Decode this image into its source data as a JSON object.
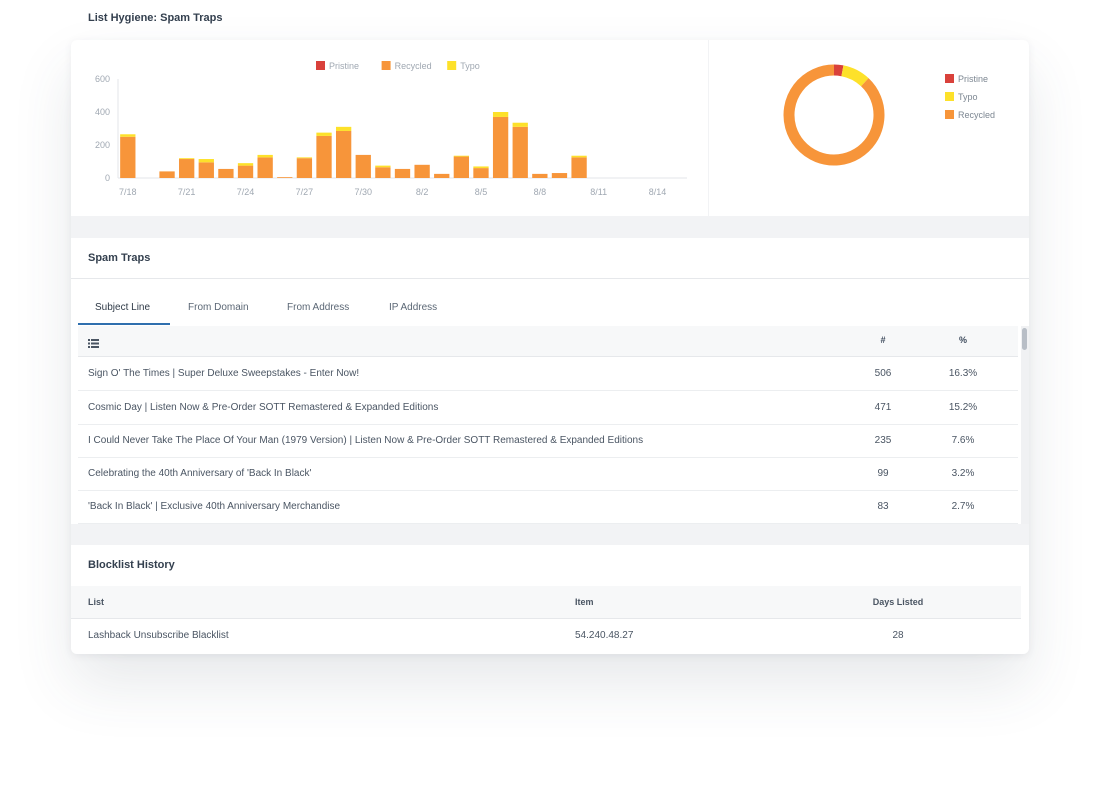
{
  "page_title": "List Hygiene: Spam Traps",
  "colors": {
    "pristine": "#d9413b",
    "recycled": "#f7953a",
    "typo": "#fde12a",
    "tab_active": "#2f6fae"
  },
  "chart_data": [
    {
      "type": "bar",
      "stacked": true,
      "x_tick_labels": [
        "7/18",
        "7/21",
        "7/24",
        "7/27",
        "7/30",
        "8/2",
        "8/5",
        "8/8",
        "8/11",
        "8/14"
      ],
      "categories": [
        "7/18",
        "7/19",
        "7/20",
        "7/21",
        "7/22",
        "7/23",
        "7/24",
        "7/25",
        "7/26",
        "7/27",
        "7/28",
        "7/29",
        "7/30",
        "7/31",
        "8/1",
        "8/2",
        "8/3",
        "8/4",
        "8/5",
        "8/6",
        "8/7",
        "8/8",
        "8/9",
        "8/10",
        "8/11",
        "8/12",
        "8/13",
        "8/14",
        "8/15"
      ],
      "series": [
        {
          "name": "Pristine",
          "values": [
            0,
            0,
            0,
            0,
            0,
            0,
            0,
            0,
            0,
            0,
            0,
            0,
            0,
            0,
            0,
            0,
            0,
            0,
            0,
            0,
            0,
            0,
            0,
            0,
            0,
            0,
            0,
            0,
            0
          ]
        },
        {
          "name": "Recycled",
          "values": [
            250,
            0,
            40,
            115,
            95,
            55,
            75,
            125,
            5,
            120,
            255,
            285,
            140,
            65,
            55,
            80,
            25,
            130,
            60,
            370,
            310,
            25,
            30,
            125,
            0,
            0,
            0,
            0,
            0
          ]
        },
        {
          "name": "Typo",
          "values": [
            15,
            0,
            0,
            5,
            20,
            0,
            15,
            15,
            0,
            5,
            20,
            25,
            0,
            10,
            0,
            0,
            0,
            5,
            10,
            30,
            25,
            0,
            0,
            10,
            0,
            0,
            0,
            0,
            0
          ]
        }
      ],
      "yticks": [
        0,
        200,
        400,
        600
      ],
      "ylim": [
        0,
        600
      ],
      "legend_position": "top-center",
      "grid": false
    },
    {
      "type": "pie",
      "donut": true,
      "labels": [
        "Pristine",
        "Typo",
        "Recycled"
      ],
      "values": [
        3,
        9,
        88
      ],
      "legend_position": "right"
    }
  ],
  "spam_traps": {
    "title": "Spam Traps",
    "tabs": [
      "Subject Line",
      "From Domain",
      "From Address",
      "IP Address"
    ],
    "active_tab": 0,
    "columns": {
      "list_icon": "list-icon",
      "count": "#",
      "percent": "%"
    },
    "rows": [
      {
        "subject": "Sign O' The Times | Super Deluxe Sweepstakes - Enter Now!",
        "count": "506",
        "percent": "16.3%"
      },
      {
        "subject": "Cosmic Day | Listen Now & Pre-Order SOTT Remastered & Expanded Editions",
        "count": "471",
        "percent": "15.2%"
      },
      {
        "subject": "I Could Never Take The Place Of Your Man (1979 Version) | Listen Now & Pre-Order SOTT Remastered & Expanded Editions",
        "count": "235",
        "percent": "7.6%"
      },
      {
        "subject": "Celebrating the 40th Anniversary of 'Back In Black'",
        "count": "99",
        "percent": "3.2%"
      },
      {
        "subject": "'Back In Black' | Exclusive 40th Anniversary Merchandise",
        "count": "83",
        "percent": "2.7%"
      }
    ]
  },
  "blocklist": {
    "title": "Blocklist History",
    "columns": {
      "list": "List",
      "item": "Item",
      "days": "Days Listed"
    },
    "rows": [
      {
        "list": "Lashback Unsubscribe Blacklist",
        "item": "54.240.48.27",
        "days": "28"
      }
    ]
  }
}
